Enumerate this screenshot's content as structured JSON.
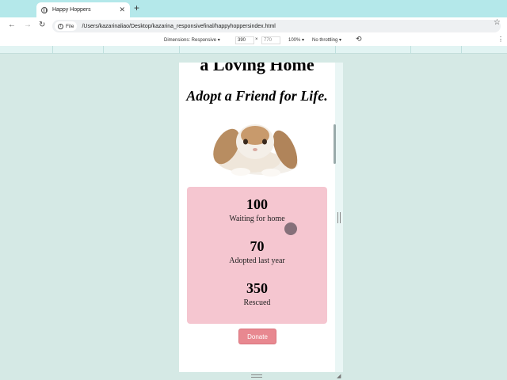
{
  "browser": {
    "tab_title": "Happy Hoppers",
    "tab_close": "✕",
    "new_tab": "+",
    "file_chip": "File",
    "url": "/Users/kazarinaliao/Desktop/kazarina_responsivefinal/happyhoppersindex.html"
  },
  "device_toolbar": {
    "dimensions": "Dimensions: Responsive",
    "width": "390",
    "times": "×",
    "height": "770",
    "zoom": "100%",
    "throttling": "No throttling"
  },
  "page": {
    "heading1": "a Loving Home",
    "heading2": "Adopt a Friend for Life.",
    "stats": [
      {
        "number": "100",
        "label": "Waiting for home"
      },
      {
        "number": "70",
        "label": "Adopted last year"
      },
      {
        "number": "350",
        "label": "Rescued"
      }
    ],
    "donate_label": "Donate"
  },
  "colors": {
    "tabstrip": "#b4e8ea",
    "stats_bg": "#f5c6d0",
    "donate_bg": "#e88890"
  }
}
